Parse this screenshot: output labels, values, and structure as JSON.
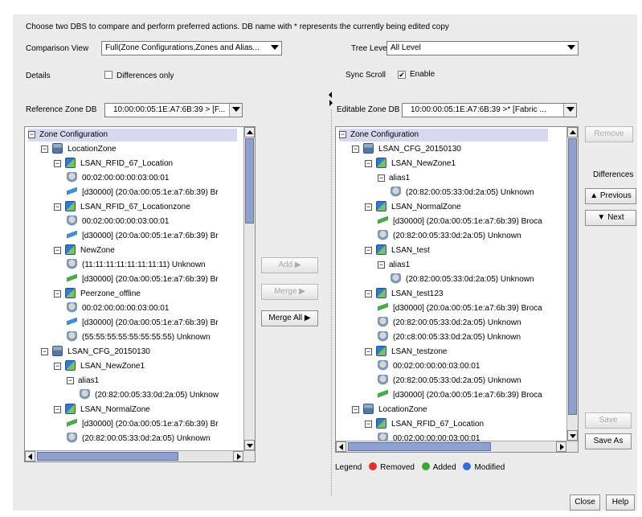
{
  "header": {
    "instruction": "Choose two DBS to compare and perform preferred actions. DB name with * represents the currently being edited copy"
  },
  "controls": {
    "comparison_view_label": "Comparison View",
    "comparison_view_value": "Full(Zone Configurations,Zones and Alias...",
    "tree_level_label": "Tree Level",
    "tree_level_value": "All Level",
    "details_label": "Details",
    "differences_only_label": "Differences only",
    "differences_only_checked": false,
    "sync_scroll_label": "Sync Scroll",
    "enable_label": "Enable",
    "enable_checked": true,
    "reference_zone_db_label": "Reference Zone DB",
    "reference_zone_db_value": "10:00:00:05:1E:A7:6B:39 > [F...",
    "editable_zone_db_label": "Editable Zone DB",
    "editable_zone_db_value": "10:00:00:05:1E:A7:6B:39 >* [Fabric ..."
  },
  "left_tree": [
    {
      "text": "Zone Configuration",
      "icon": "none",
      "exp": "minus",
      "indent": 0
    },
    {
      "text": "LocationZone",
      "icon": "config",
      "exp": "minus",
      "indent": 1
    },
    {
      "text": "LSAN_RFID_67_Location",
      "icon": "zone",
      "exp": "minus",
      "indent": 2
    },
    {
      "text": "00:02:00:00:00:03:00:01",
      "icon": "port",
      "exp": "",
      "indent": 3
    },
    {
      "text": "[d30000]  (20:0a:00:05:1e:a7:6b:39) Br",
      "icon": "device-blue",
      "exp": "",
      "indent": 3
    },
    {
      "text": "LSAN_RFID_67_Locationzone",
      "icon": "zone",
      "exp": "minus",
      "indent": 2
    },
    {
      "text": "00:02:00:00:00:03:00:01",
      "icon": "port",
      "exp": "",
      "indent": 3
    },
    {
      "text": "[d30000]  (20:0a:00:05:1e:a7:6b:39) Br",
      "icon": "device-blue",
      "exp": "",
      "indent": 3
    },
    {
      "text": "NewZone",
      "icon": "zone",
      "exp": "minus",
      "indent": 2
    },
    {
      "text": "(11:11:11:11:11:11:11:11) Unknown",
      "icon": "port",
      "exp": "",
      "indent": 3
    },
    {
      "text": "[d30000]  (20:0a:00:05:1e:a7:6b:39) Br",
      "icon": "device",
      "exp": "",
      "indent": 3
    },
    {
      "text": "Peerzone_offline",
      "icon": "zone",
      "exp": "minus",
      "indent": 2
    },
    {
      "text": "00:02:00:00:00:03:00:01",
      "icon": "port",
      "exp": "",
      "indent": 3
    },
    {
      "text": "[d30000]  (20:0a:00:05:1e:a7:6b:39) Br",
      "icon": "device-blue",
      "exp": "",
      "indent": 3
    },
    {
      "text": "(55:55:55:55:55:55:55:55) Unknown",
      "icon": "port",
      "exp": "",
      "indent": 3
    },
    {
      "text": "LSAN_CFG_20150130",
      "icon": "config",
      "exp": "minus",
      "indent": 1
    },
    {
      "text": "LSAN_NewZone1",
      "icon": "zone",
      "exp": "minus",
      "indent": 2
    },
    {
      "text": "alias1",
      "icon": "none",
      "exp": "minus",
      "indent": 3
    },
    {
      "text": "(20:82:00:05:33:0d:2a:05) Unknow",
      "icon": "port",
      "exp": "",
      "indent": 4
    },
    {
      "text": "LSAN_NormalZone",
      "icon": "zone",
      "exp": "minus",
      "indent": 2
    },
    {
      "text": "[d30000]  (20:0a:00:05:1e:a7:6b:39) Br",
      "icon": "device",
      "exp": "",
      "indent": 3
    },
    {
      "text": "(20:82:00:05:33:0d:2a:05) Unknown",
      "icon": "port",
      "exp": "",
      "indent": 3
    }
  ],
  "right_tree": [
    {
      "text": "Zone Configuration",
      "icon": "none",
      "exp": "minus",
      "indent": 0
    },
    {
      "text": "LSAN_CFG_20150130",
      "icon": "config",
      "exp": "minus",
      "indent": 1
    },
    {
      "text": "LSAN_NewZone1",
      "icon": "zone",
      "exp": "minus",
      "indent": 2
    },
    {
      "text": "alias1",
      "icon": "none",
      "exp": "minus",
      "indent": 3
    },
    {
      "text": "(20:82:00:05:33:0d:2a:05) Unknown",
      "icon": "port",
      "exp": "",
      "indent": 4
    },
    {
      "text": "LSAN_NormalZone",
      "icon": "zone",
      "exp": "minus",
      "indent": 2
    },
    {
      "text": "[d30000]  (20:0a:00:05:1e:a7:6b:39) Broca",
      "icon": "device",
      "exp": "",
      "indent": 3
    },
    {
      "text": "(20:82:00:05:33:0d:2a:05) Unknown",
      "icon": "port",
      "exp": "",
      "indent": 3
    },
    {
      "text": "LSAN_test",
      "icon": "zone",
      "exp": "minus",
      "indent": 2
    },
    {
      "text": "alias1",
      "icon": "none",
      "exp": "minus",
      "indent": 3
    },
    {
      "text": "(20:82:00:05:33:0d:2a:05) Unknown",
      "icon": "port",
      "exp": "",
      "indent": 4
    },
    {
      "text": "LSAN_test123",
      "icon": "zone",
      "exp": "minus",
      "indent": 2
    },
    {
      "text": "[d30000]  (20:0a:00:05:1e:a7:6b:39) Broca",
      "icon": "device",
      "exp": "",
      "indent": 3
    },
    {
      "text": "(20:82:00:05:33:0d:2a:05) Unknown",
      "icon": "port",
      "exp": "",
      "indent": 3
    },
    {
      "text": "(20:c8:00:05:33:0d:2a:05) Unknown",
      "icon": "port",
      "exp": "",
      "indent": 3
    },
    {
      "text": "LSAN_testzone",
      "icon": "zone",
      "exp": "minus",
      "indent": 2
    },
    {
      "text": "00:02:00:00:00:03:00:01",
      "icon": "port",
      "exp": "",
      "indent": 3
    },
    {
      "text": "(20:82:00:05:33:0d:2a:05) Unknown",
      "icon": "port",
      "exp": "",
      "indent": 3
    },
    {
      "text": "[d30000]  (20:0a:00:05:1e:a7:6b:39) Broca",
      "icon": "device",
      "exp": "",
      "indent": 3
    },
    {
      "text": "LocationZone",
      "icon": "config",
      "exp": "minus",
      "indent": 1
    },
    {
      "text": "LSAN_RFID_67_Location",
      "icon": "zone",
      "exp": "minus",
      "indent": 2
    },
    {
      "text": "00:02:00:00:00:03:00:01",
      "icon": "port",
      "exp": "",
      "indent": 3
    }
  ],
  "middle_buttons": {
    "add": "Add",
    "merge": "Merge",
    "merge_all": "Merge All"
  },
  "right_buttons": {
    "remove": "Remove",
    "differences_label": "Differences",
    "previous": "Previous",
    "next": "Next",
    "save": "Save",
    "save_as": "Save As"
  },
  "legend": {
    "label": "Legend",
    "removed": "Removed",
    "added": "Added",
    "modified": "Modified",
    "removed_color": "#e03030",
    "added_color": "#3aa63a",
    "modified_color": "#3a6fd0"
  },
  "footer": {
    "close": "Close",
    "help": "Help"
  }
}
